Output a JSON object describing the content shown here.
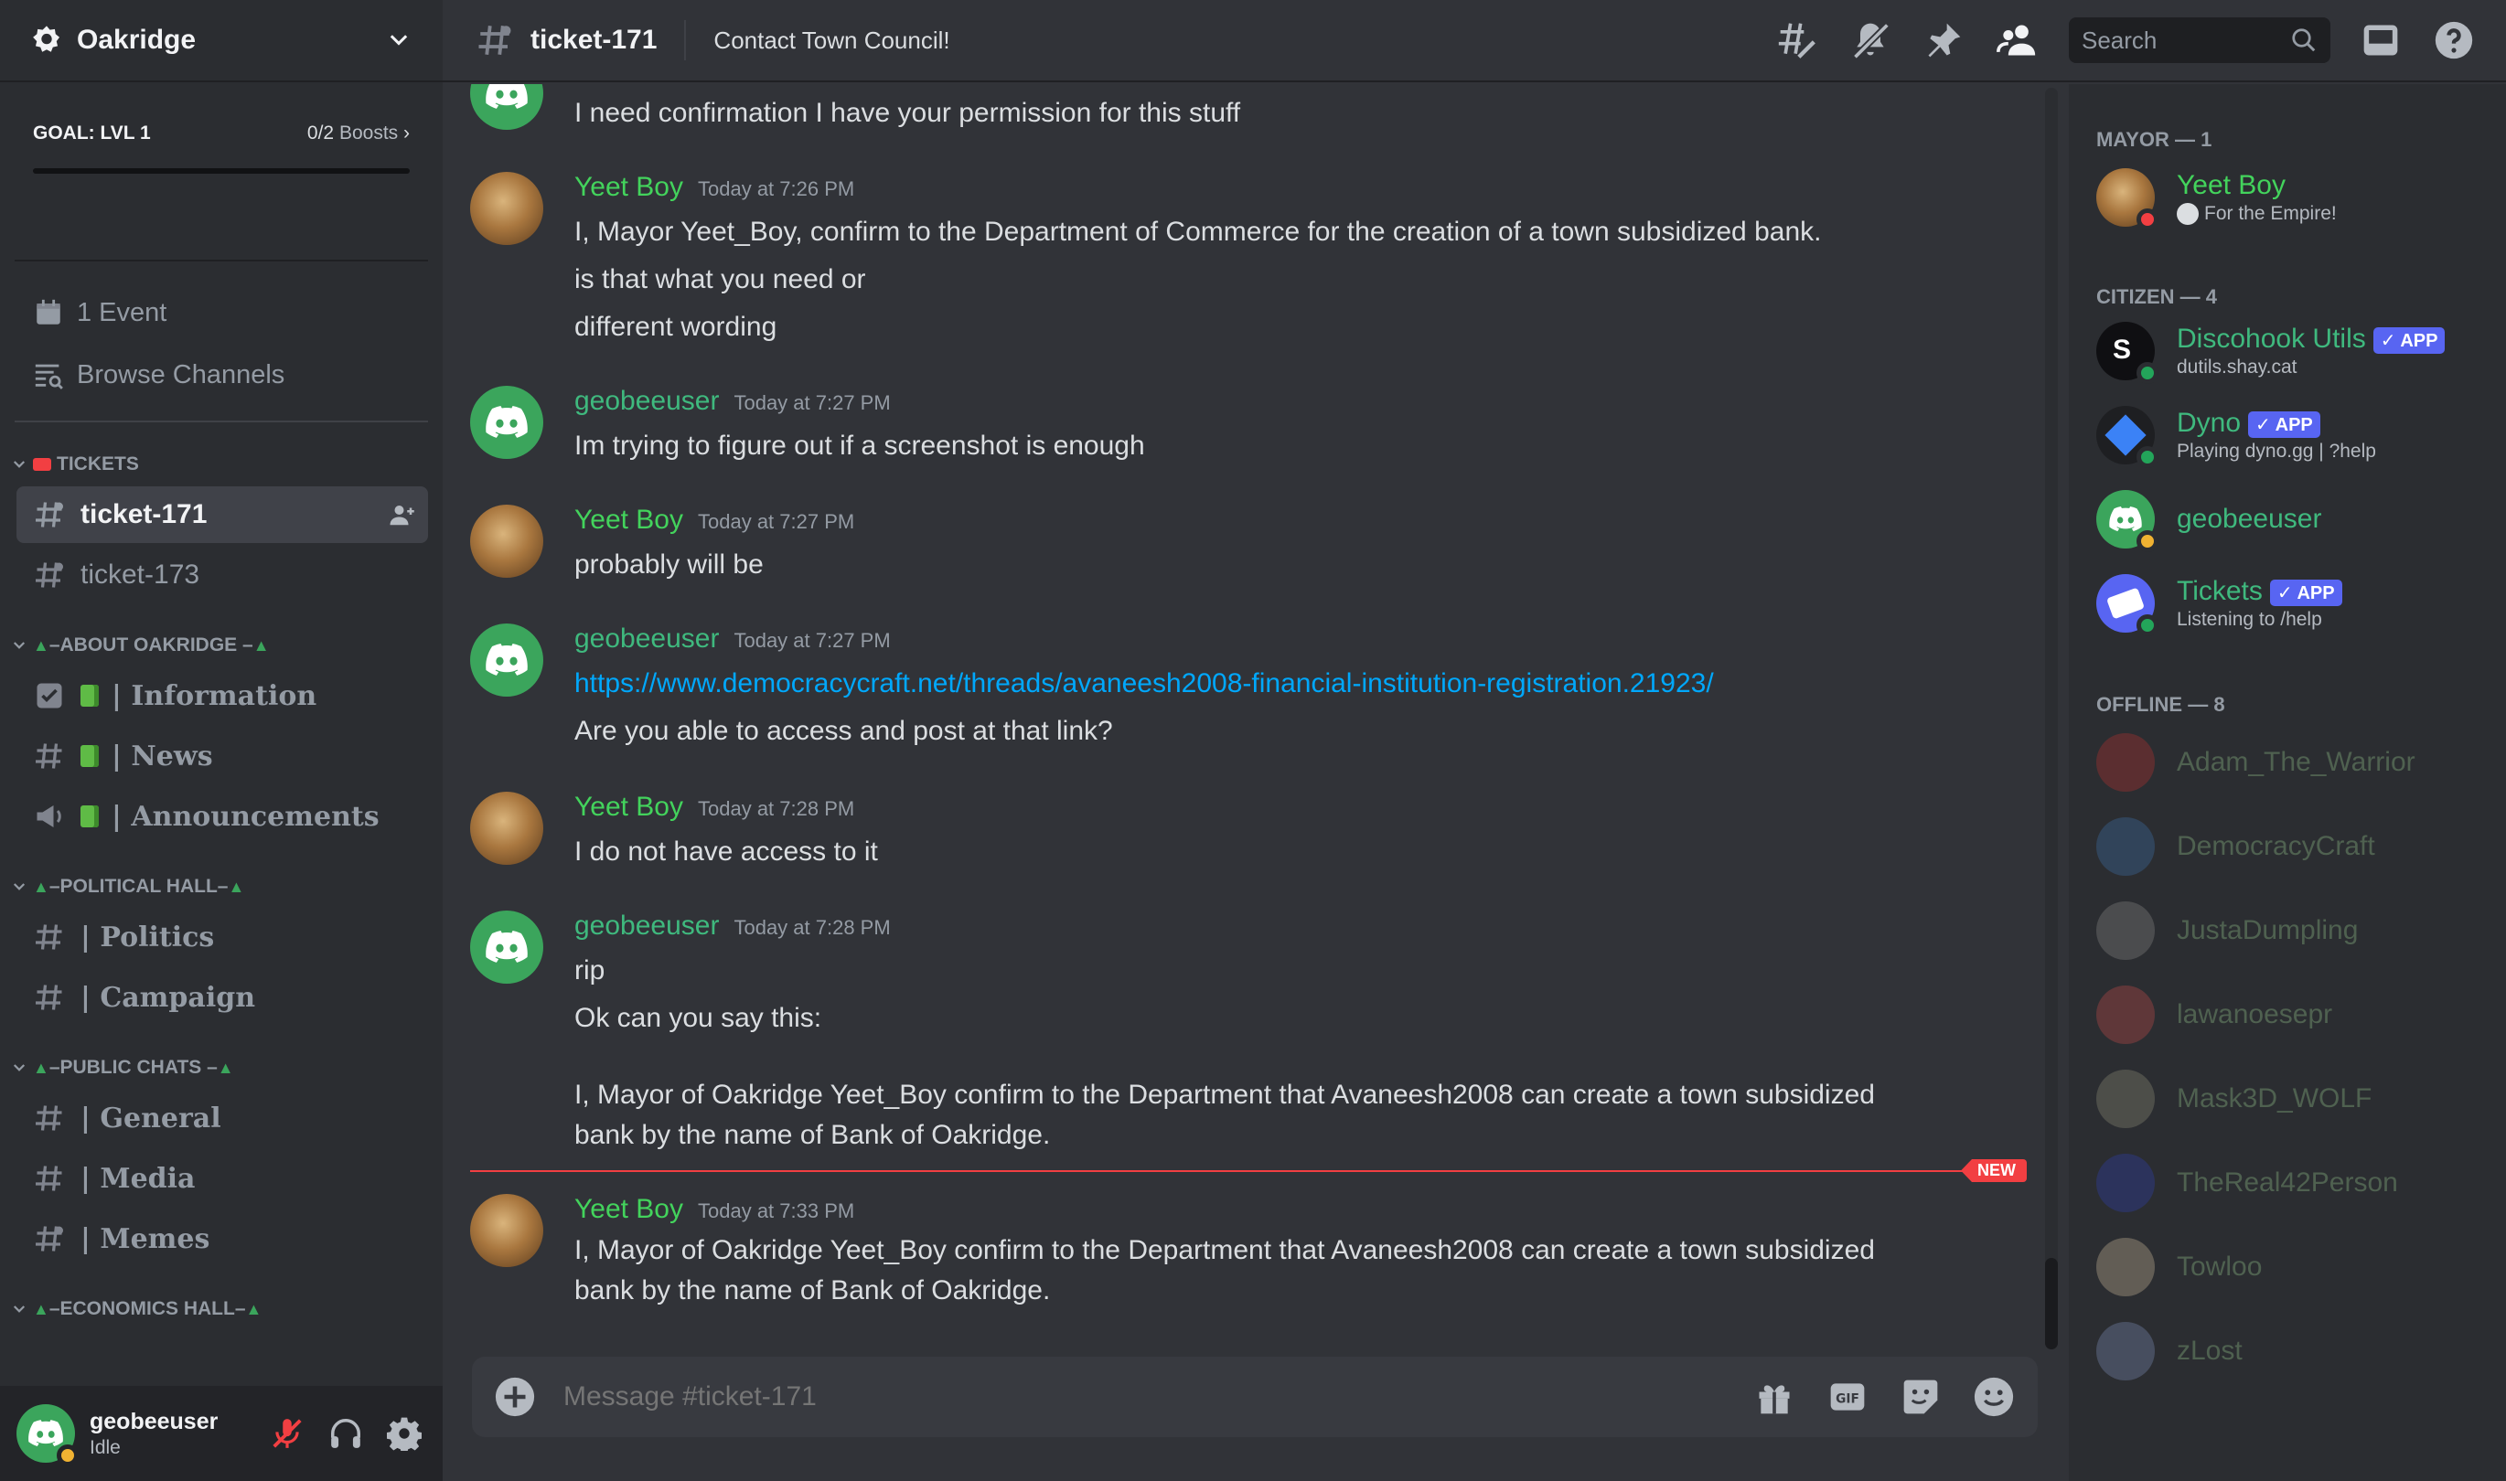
{
  "server": {
    "name": "Oakridge"
  },
  "goal": {
    "label": "GOAL: LVL 1",
    "progress": "0/2",
    "boosts_label": "Boosts",
    "fraction": 0
  },
  "side_links": [
    {
      "label": "1 Event"
    },
    {
      "label": "Browse Channels"
    }
  ],
  "categories": {
    "tickets": "TICKETS",
    "about": "–ABOUT OAKRIDGE –",
    "political": "–POLITICAL HALL–",
    "public": "–PUBLIC CHATS –",
    "economics": "–ECONOMICS HALL–"
  },
  "channels": {
    "ticket_171": "ticket-171",
    "ticket_173": "ticket-173",
    "information": "| Information",
    "news": "| News",
    "announcements": "| Announcements",
    "politics": "| Politics",
    "campaign": "| Campaign",
    "general": "| General",
    "media": "| Media",
    "memes": "| Memes"
  },
  "user": {
    "name": "geobeeuser",
    "status": "Idle"
  },
  "topbar": {
    "channel": "ticket-171",
    "topic": "Contact Town Council!",
    "search_placeholder": "Search"
  },
  "messages": [
    {
      "author": "geobeeuser",
      "time": "",
      "lines": [
        "I need confirmation I have your permission for this stuff"
      ]
    },
    {
      "author": "Yeet Boy",
      "time": "Today at 7:26 PM",
      "lines": [
        "I, Mayor Yeet_Boy, confirm to the Department of Commerce for the creation of a town subsidized bank.",
        "is that what you need or",
        "different wording"
      ]
    },
    {
      "author": "geobeeuser",
      "time": "Today at 7:27 PM",
      "lines": [
        "Im trying to figure out if a screenshot is enough"
      ]
    },
    {
      "author": "Yeet Boy",
      "time": "Today at 7:27 PM",
      "lines": [
        "probably will be"
      ]
    },
    {
      "author": "geobeeuser",
      "time": "Today at 7:27 PM",
      "link": "https://www.democracycraft.net/threads/avaneesh2008-financial-institution-registration.21923/",
      "lines": [
        "Are you able to access and post at that link?"
      ]
    },
    {
      "author": "Yeet Boy",
      "time": "Today at 7:28 PM",
      "lines": [
        "I do not have access to it"
      ]
    },
    {
      "author": "geobeeuser",
      "time": "Today at 7:28 PM",
      "lines": [
        "rip",
        "Ok can you say this:",
        "I, Mayor of Oakridge Yeet_Boy confirm to the Department that Avaneesh2008 can create a town subsidized",
        "bank by the name of Bank of Oakridge."
      ]
    },
    {
      "author": "Yeet Boy",
      "time": "Today at 7:33 PM",
      "lines": [
        "I, Mayor of Oakridge Yeet_Boy confirm to the Department that Avaneesh2008 can create a town subsidized",
        "bank by the name of Bank of Oakridge."
      ]
    }
  ],
  "new_badge": "NEW",
  "composer": {
    "placeholder": "Message #ticket-171"
  },
  "members": {
    "mayor_header": "MAYOR — 1",
    "citizen_header": "CITIZEN — 4",
    "offline_header": "OFFLINE — 8",
    "mayor": [
      {
        "name": "Yeet Boy",
        "sub": "For the Empire!"
      }
    ],
    "citizens": [
      {
        "name": "Discohook Utils",
        "badge": "APP",
        "sub": "dutils.shay.cat"
      },
      {
        "name": "Dyno",
        "badge": "APP",
        "sub": "Playing dyno.gg | ?help"
      },
      {
        "name": "geobeeuser",
        "sub": ""
      },
      {
        "name": "Tickets",
        "badge": "APP",
        "sub": "Listening to /help"
      }
    ],
    "offline": [
      {
        "name": "Adam_The_Warrior",
        "color": "#b43030"
      },
      {
        "name": "DemocracyCraft",
        "color": "#3d6fa8"
      },
      {
        "name": "JustaDumpling",
        "color": "#888888"
      },
      {
        "name": "lawanoesepr",
        "color": "#c04a4a"
      },
      {
        "name": "Mask3D_WOLF",
        "color": "#8b8b78"
      },
      {
        "name": "TheReal42Person",
        "color": "#2d3fb0"
      },
      {
        "name": "Towloo",
        "color": "#c8b89c"
      },
      {
        "name": "zLost",
        "color": "#7c8cb8"
      }
    ]
  },
  "colors": {
    "accent": "#5865f2",
    "online": "#23a55a",
    "dnd": "#f23f42",
    "idle": "#f0b232",
    "new_line": "#f23f42"
  }
}
